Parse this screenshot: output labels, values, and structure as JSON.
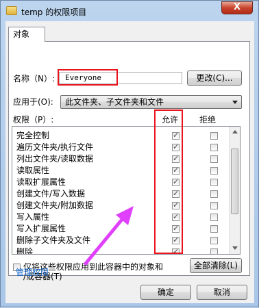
{
  "window": {
    "title": "temp 的权限项目",
    "close_glyph": "X"
  },
  "tab": {
    "label": "对象"
  },
  "name_row": {
    "label": "名称（N）:",
    "value": "Everyone",
    "change_button": "更改(C)..."
  },
  "apply_row": {
    "label": "应用于(O):",
    "selected": "此文件夹、子文件夹和文件"
  },
  "permissions": {
    "label": "权限（P）:",
    "allow_header": "允许",
    "deny_header": "拒绝",
    "items": [
      {
        "name": "完全控制",
        "allow": true,
        "deny": false
      },
      {
        "name": "遍历文件夹/执行文件",
        "allow": true,
        "deny": false
      },
      {
        "name": "列出文件夹/读取数据",
        "allow": true,
        "deny": false
      },
      {
        "name": "读取属性",
        "allow": true,
        "deny": false
      },
      {
        "name": "读取扩展属性",
        "allow": true,
        "deny": false
      },
      {
        "name": "创建文件/写入数据",
        "allow": true,
        "deny": false
      },
      {
        "name": "创建文件夹/附加数据",
        "allow": true,
        "deny": false
      },
      {
        "name": "写入属性",
        "allow": true,
        "deny": false
      },
      {
        "name": "写入扩展属性",
        "allow": true,
        "deny": false
      },
      {
        "name": "删除子文件夹及文件",
        "allow": true,
        "deny": false
      },
      {
        "name": "删除",
        "allow": true,
        "deny": false
      }
    ]
  },
  "apply_only": {
    "line1": "仅将这些权限应用到此容器中的对象和",
    "line2": "/或容器(T)",
    "checked": false
  },
  "clear_all_button": "全部清除(L)",
  "manage_link": "管理权限",
  "ok_button": "确定",
  "cancel_button": "取消",
  "colors": {
    "highlight": "#e8141e",
    "annotation_arrow": "#e040fb",
    "link": "#0b5fc6"
  }
}
